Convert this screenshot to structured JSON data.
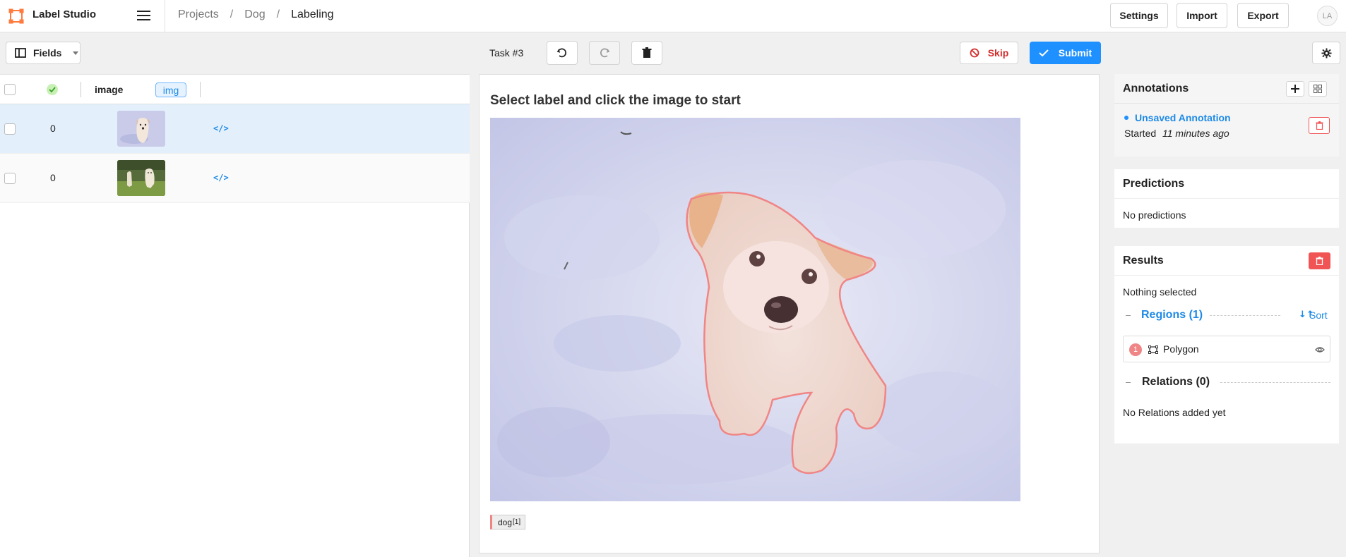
{
  "header": {
    "app_title": "Label Studio",
    "breadcrumb": [
      "Projects",
      "Dog",
      "Labeling"
    ],
    "buttons": {
      "settings": "Settings",
      "import": "Import",
      "export": "Export"
    },
    "avatar": "LA"
  },
  "toolbar": {
    "fields_label": "Fields",
    "task_label": "Task #3",
    "skip_label": "Skip",
    "submit_label": "Submit"
  },
  "table": {
    "columns": {
      "image": "image",
      "img_tag": "img"
    },
    "rows": [
      {
        "count": "0",
        "selected": true
      },
      {
        "count": "0",
        "selected": false
      }
    ]
  },
  "main": {
    "instruction": "Select label and click the image to start",
    "label_chip": {
      "text": "dog",
      "count": "[1]"
    }
  },
  "annotations": {
    "title": "Annotations",
    "item_name": "Unsaved Annotation",
    "started_prefix": "Started",
    "started_when": "11 minutes ago"
  },
  "predictions": {
    "title": "Predictions",
    "empty": "No predictions"
  },
  "results": {
    "title": "Results",
    "nothing_selected": "Nothing selected",
    "regions_label": "Regions (1)",
    "sort_label": "Sort",
    "region": {
      "index": "1",
      "type": "Polygon"
    },
    "relations_label": "Relations (0)",
    "relations_empty": "No Relations added yet"
  },
  "colors": {
    "accent": "#1e90ff",
    "danger": "#f05454",
    "region": "#f08585"
  }
}
